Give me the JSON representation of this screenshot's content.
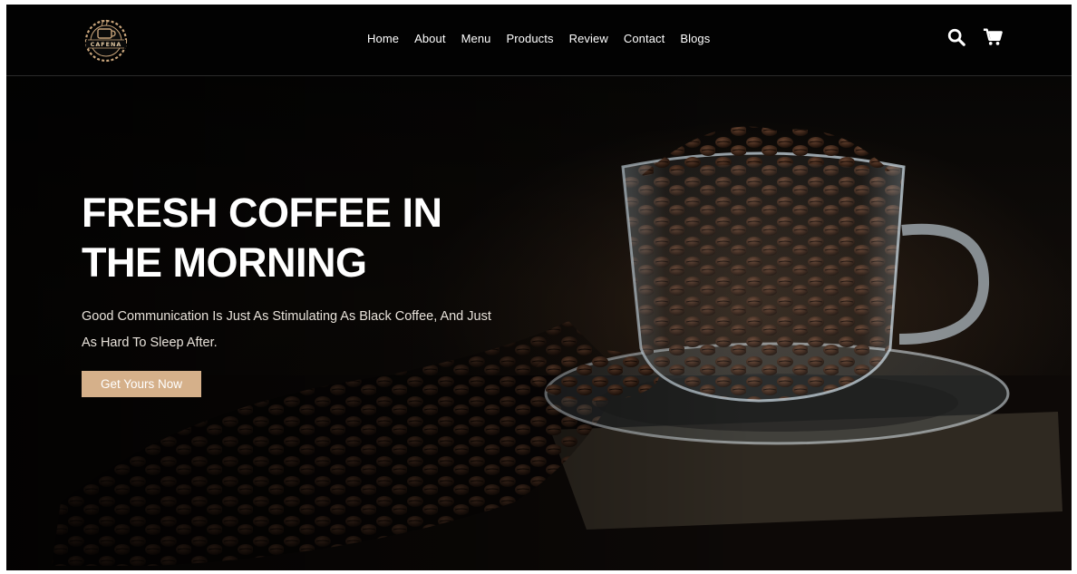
{
  "brand": {
    "logo_text": "CAFENA",
    "accent_color": "#d5b08a"
  },
  "nav": {
    "items": [
      {
        "label": "Home"
      },
      {
        "label": "About"
      },
      {
        "label": "Menu"
      },
      {
        "label": "Products"
      },
      {
        "label": "Review"
      },
      {
        "label": "Contact"
      },
      {
        "label": "Blogs"
      }
    ]
  },
  "header_icons": [
    "search-icon",
    "cart-icon"
  ],
  "hero": {
    "title": "FRESH COFFEE IN\nTHE MORNING",
    "subtitle": "Good Communication Is Just As Stimulating As Black Coffee, And Just As Hard To Sleep After.",
    "cta_label": "Get Yours Now",
    "background_image": "coffee beans in a glass cup on a saucer"
  }
}
